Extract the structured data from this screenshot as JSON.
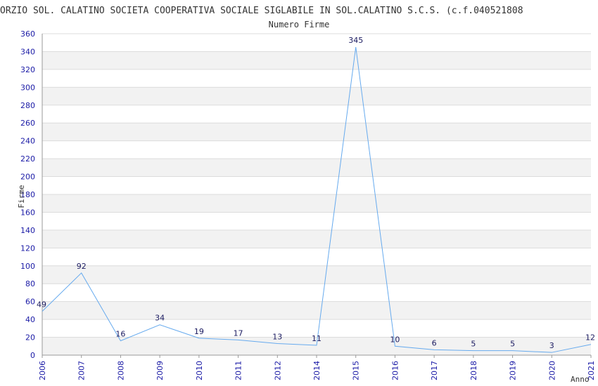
{
  "chart_data": {
    "type": "line",
    "title": "ORZIO SOL. CALATINO SOCIETA COOPERATIVA SOCIALE SIGLABILE IN SOL.CALATINO S.C.S. (c.f.040521808",
    "subtitle": "Numero Firme",
    "xlabel": "Anno",
    "ylabel": "Firme",
    "ylim": [
      0,
      360
    ],
    "y_ticks": [
      0,
      20,
      40,
      60,
      80,
      100,
      120,
      140,
      160,
      180,
      200,
      220,
      240,
      260,
      280,
      300,
      320,
      340,
      360
    ],
    "categories": [
      "2006",
      "2007",
      "2008",
      "2009",
      "2010",
      "2011",
      "2012",
      "2014",
      "2015",
      "2016",
      "2017",
      "2018",
      "2019",
      "2020",
      "2021"
    ],
    "values": [
      49,
      92,
      16,
      34,
      19,
      17,
      13,
      11,
      345,
      10,
      6,
      5,
      5,
      3,
      12
    ],
    "grid": true,
    "line_color": "#66aaee",
    "band_color": "#f2f2f2",
    "tick_color": "#1a1aa6"
  }
}
